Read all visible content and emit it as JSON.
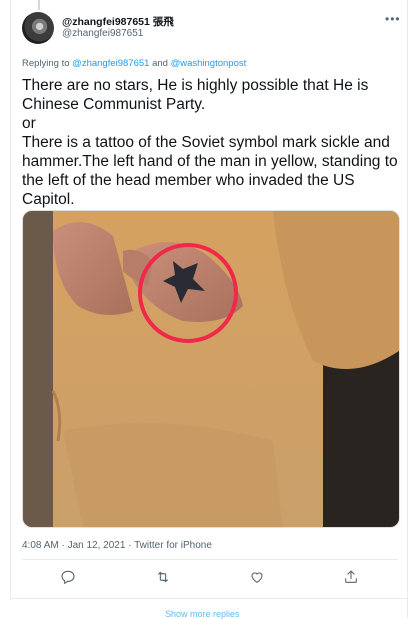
{
  "tweet": {
    "display_name": "@zhangfei987651 張飛",
    "handle": "@zhangfei987651",
    "replying_prefix": "Replying to",
    "replying_to_1": "@zhangfei987651",
    "replying_and": "and",
    "replying_to_2": "@washingtonpost",
    "text_lines": [
      "There are no stars, He is highly possible that He is Chinese Communist Party.",
      "or",
      "There is a tattoo of the Soviet symbol mark sickle and hammer.The left hand of the man in yellow, standing to the left of the head member who invaded the US Capitol."
    ],
    "timestamp": "4:08 AM · Jan 12, 2021 · Twitter for iPhone"
  },
  "actions": {
    "reply_icon": "reply-icon",
    "retweet_icon": "retweet-icon",
    "like_icon": "heart-icon",
    "share_icon": "share-icon"
  },
  "footer": {
    "show_more": "Show more replies"
  },
  "colors": {
    "link": "#1d9bf0",
    "secondary_text": "#536471",
    "divider": "#e6ecf0",
    "highlight_circle": "#f0284a"
  }
}
